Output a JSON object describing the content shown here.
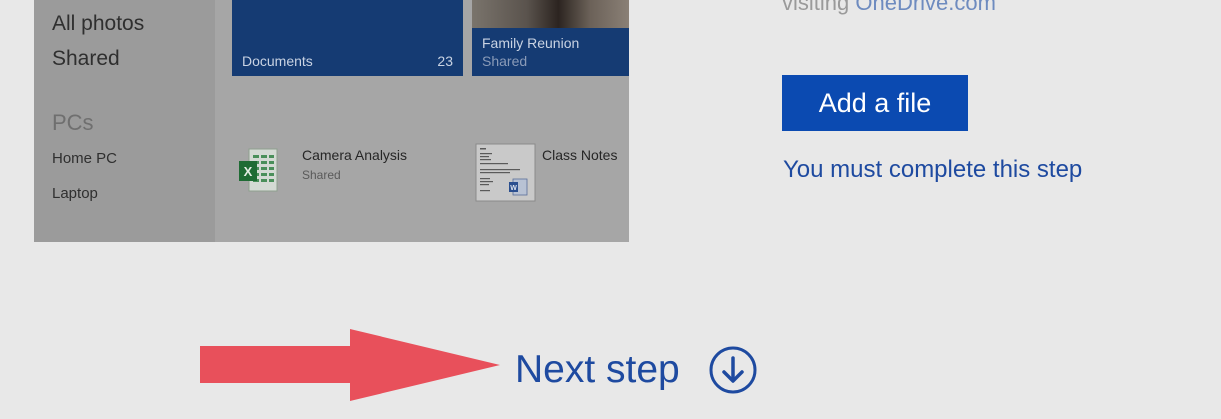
{
  "preview": {
    "nav": {
      "all_photos": "All photos",
      "shared": "Shared",
      "pcs_heading": "PCs",
      "home_pc": "Home PC",
      "laptop": "Laptop"
    },
    "tiles": {
      "documents": {
        "label": "Documents",
        "count": "23"
      },
      "family": {
        "label": "Family Reunion",
        "subtitle": "Shared"
      }
    },
    "files": {
      "camera": {
        "name": "Camera Analysis",
        "subtitle": "Shared",
        "icon": "excel-file-icon"
      },
      "notes": {
        "name": "Class Notes",
        "icon": "word-document-thumbnail"
      }
    }
  },
  "right": {
    "visit_prefix": "visiting ",
    "visit_link": "OneDrive.com",
    "add_button": "Add a file",
    "step_note": "You must complete this step"
  },
  "next_step": {
    "label": "Next step",
    "icon": "circle-down-arrow-icon"
  },
  "colors": {
    "accent": "#1e4aa0",
    "button": "#0b4ab1",
    "annotation_arrow": "#e8505b",
    "background": "#e8e8e8"
  }
}
